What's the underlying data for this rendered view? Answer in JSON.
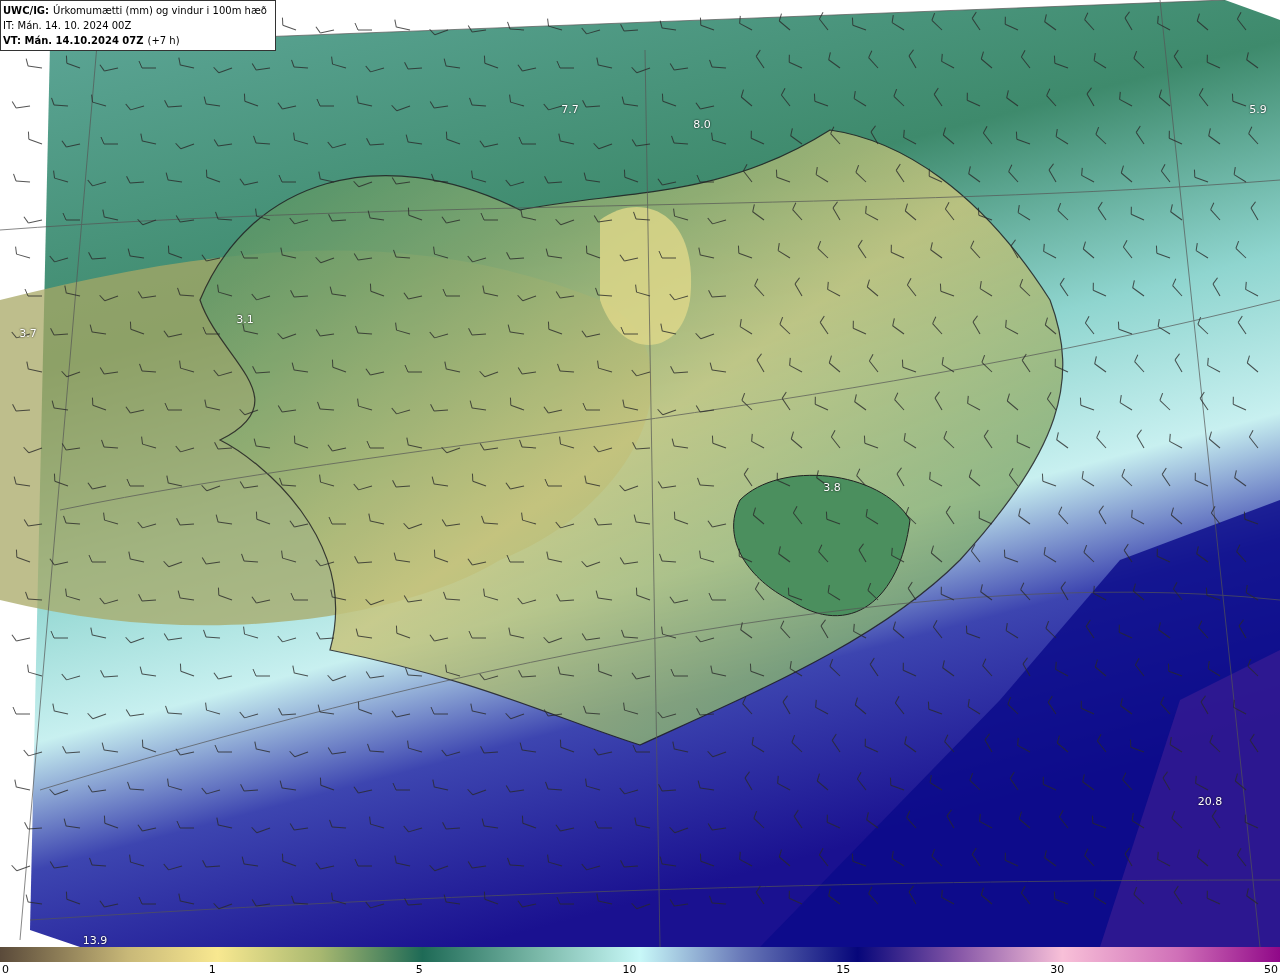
{
  "header": {
    "model": "UWC/IG:",
    "title": "Úrkomumætti (mm) og vindur i 100m hæð",
    "issue_time": "IT: Mán. 14. 10. 2024 00Z",
    "valid_prefix": "VT: Mán. 14.10.2024 07Z",
    "valid_offset": "(+7 h)"
  },
  "map": {
    "value_labels": [
      {
        "text": "7.7"
      },
      {
        "text": "8.0"
      },
      {
        "text": "5.9"
      },
      {
        "text": "3.7"
      },
      {
        "text": "3.1"
      },
      {
        "text": "3.8"
      },
      {
        "text": "20.8"
      },
      {
        "text": "13.9"
      }
    ]
  },
  "legend": {
    "ticks": [
      "0",
      "1",
      "5",
      "10",
      "15",
      "30",
      "50"
    ]
  }
}
